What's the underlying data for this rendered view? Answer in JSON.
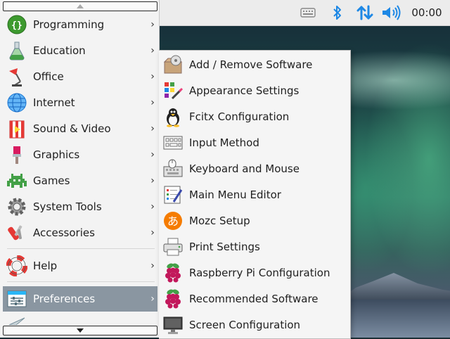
{
  "taskbar": {
    "clock": "00:00",
    "icons": [
      "keyboard-icon",
      "bluetooth-icon",
      "network-icon",
      "volume-icon"
    ]
  },
  "main_menu": {
    "items": [
      {
        "label": "Programming",
        "icon": "programming-icon"
      },
      {
        "label": "Education",
        "icon": "education-icon"
      },
      {
        "label": "Office",
        "icon": "office-icon"
      },
      {
        "label": "Internet",
        "icon": "internet-icon"
      },
      {
        "label": "Sound & Video",
        "icon": "sound-video-icon"
      },
      {
        "label": "Graphics",
        "icon": "graphics-icon"
      },
      {
        "label": "Games",
        "icon": "games-icon"
      },
      {
        "label": "System Tools",
        "icon": "system-tools-icon"
      },
      {
        "label": "Accessories",
        "icon": "accessories-icon"
      },
      {
        "label": "Help",
        "icon": "help-icon"
      },
      {
        "label": "Preferences",
        "icon": "preferences-icon",
        "selected": true
      }
    ],
    "arrow": "›"
  },
  "preferences_submenu": {
    "items": [
      {
        "label": "Add / Remove Software",
        "icon": "package-icon"
      },
      {
        "label": "Appearance Settings",
        "icon": "appearance-icon"
      },
      {
        "label": "Fcitx Configuration",
        "icon": "penguin-icon"
      },
      {
        "label": "Input Method",
        "icon": "input-method-icon"
      },
      {
        "label": "Keyboard and Mouse",
        "icon": "keyboard-mouse-icon"
      },
      {
        "label": "Main Menu Editor",
        "icon": "menu-editor-icon"
      },
      {
        "label": "Mozc Setup",
        "icon": "mozc-icon",
        "glyph": "あ"
      },
      {
        "label": "Print Settings",
        "icon": "printer-icon"
      },
      {
        "label": "Raspberry Pi Configuration",
        "icon": "raspberry-icon"
      },
      {
        "label": "Recommended Software",
        "icon": "raspberry-icon"
      },
      {
        "label": "Screen Configuration",
        "icon": "monitor-icon"
      }
    ]
  },
  "colors": {
    "selected_bg": "#8a96a1",
    "accent_blue": "#1e88e5"
  }
}
